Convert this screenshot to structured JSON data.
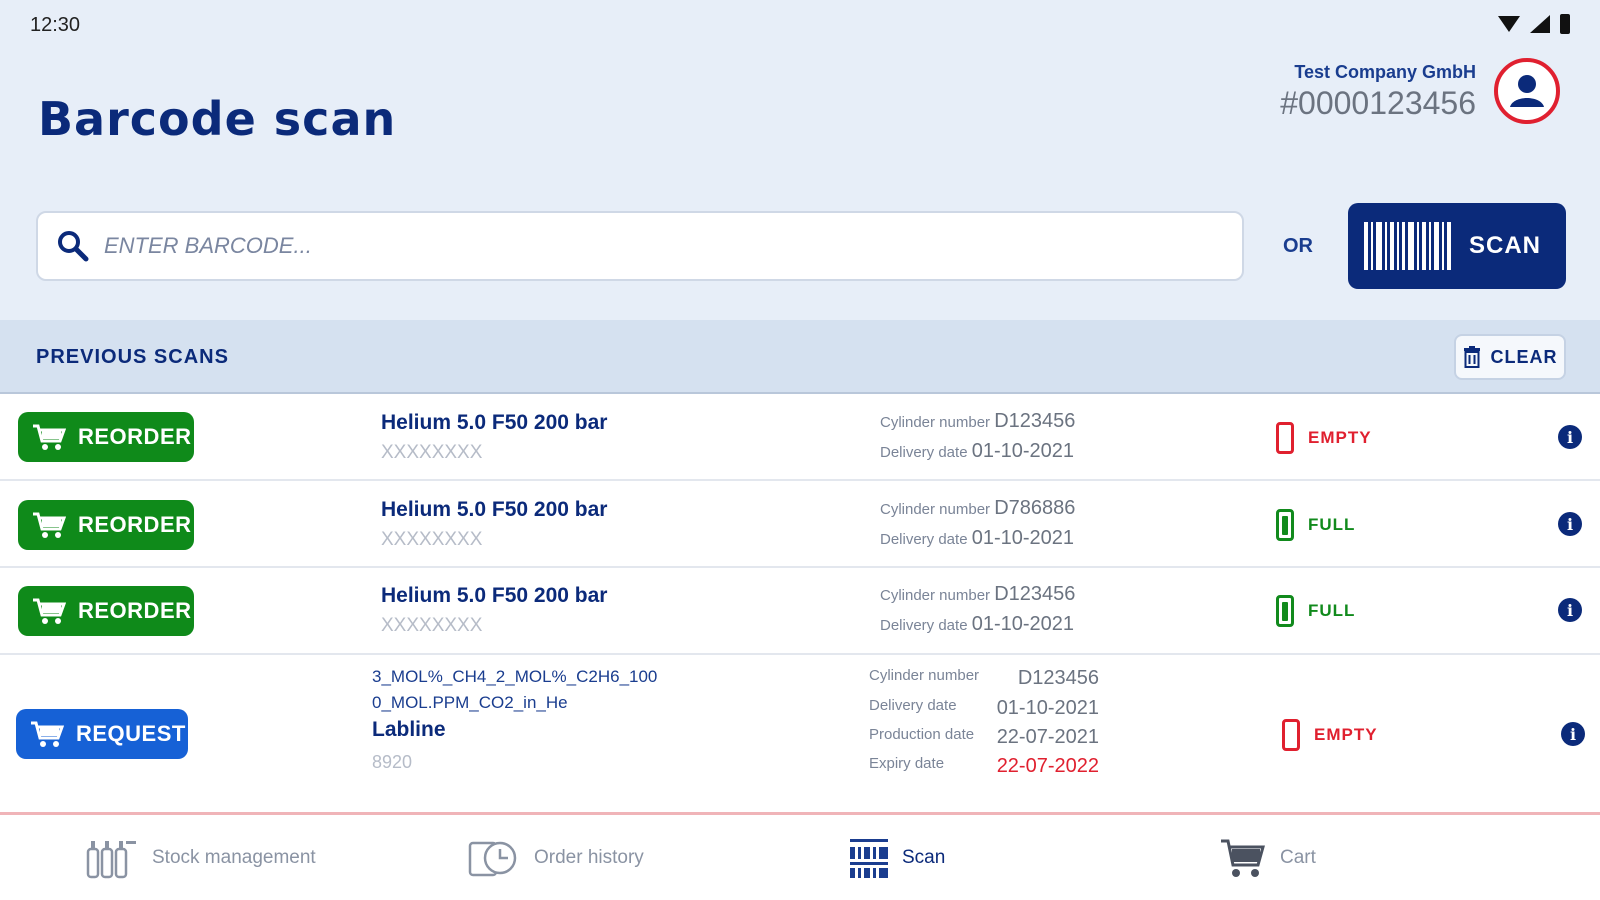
{
  "status_bar": {
    "time": "12:30"
  },
  "header": {
    "title": "Barcode scan",
    "company_name": "Test Company GmbH",
    "company_id": "#0000123456"
  },
  "search": {
    "placeholder": "ENTER BARCODE...",
    "or_label": "OR",
    "scan_label": "SCAN"
  },
  "previous_scans": {
    "title": "PREVIOUS SCANS",
    "clear_label": "CLEAR",
    "rows": [
      {
        "action": "REORDER",
        "name": "Helium 5.0 F50 200 bar",
        "sub": "XXXXXXXX",
        "cyl_label": "Cylinder number",
        "cyl": "D123456",
        "del_label": "Delivery date",
        "del": "01-10-2021",
        "status": "EMPTY"
      },
      {
        "action": "REORDER",
        "name": "Helium 5.0 F50 200 bar",
        "sub": "XXXXXXXX",
        "cyl_label": "Cylinder number",
        "cyl": "D786886",
        "del_label": "Delivery date",
        "del": "01-10-2021",
        "status": "FULL"
      },
      {
        "action": "REORDER",
        "name": "Helium 5.0 F50 200 bar",
        "sub": "XXXXXXXX",
        "cyl_label": "Cylinder number",
        "cyl": "D123456",
        "del_label": "Delivery date",
        "del": "01-10-2021",
        "status": "FULL"
      }
    ],
    "request_row": {
      "action": "REQUEST",
      "code_line1": "3_MOL%_CH4_2_MOL%_C2H6_100",
      "code_line2": "0_MOL.PPM_CO2_in_He",
      "product": "Labline",
      "number": "8920",
      "cyl_label": "Cylinder number",
      "cyl": "D123456",
      "del_label": "Delivery date",
      "del": "01-10-2021",
      "prod_label": "Production date",
      "prod": "22-07-2021",
      "exp_label": "Expiry date",
      "exp": "22-07-2022",
      "status": "EMPTY"
    }
  },
  "nav": {
    "stock": "Stock management",
    "orders": "Order history",
    "scan": "Scan",
    "cart": "Cart"
  },
  "colors": {
    "primary": "#0b2a7a",
    "reorder": "#0f8a1a",
    "request": "#1661d6",
    "empty": "#e0202f",
    "full": "#118a1c"
  }
}
